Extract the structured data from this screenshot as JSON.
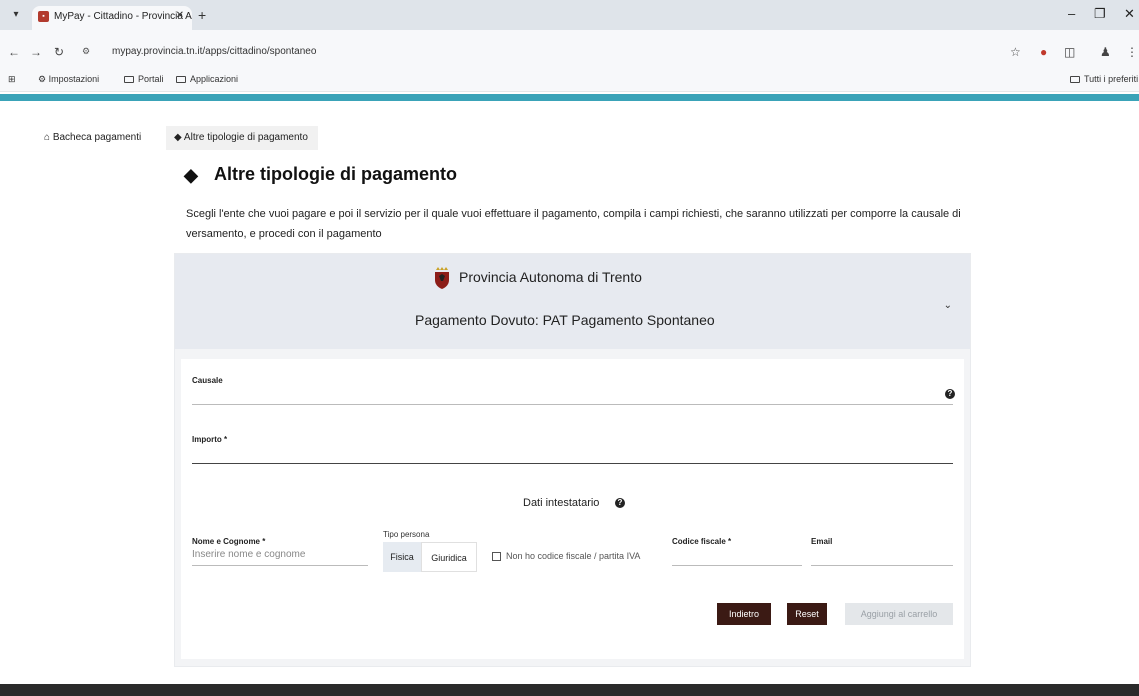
{
  "browser": {
    "tab_title": "MyPay - Cittadino - Provincia A",
    "url": "mypay.provincia.tn.it/apps/cittadino/spontaneo",
    "bookmarks": [
      "Impostazioni",
      "Portali",
      "Applicazioni"
    ],
    "bookmarks_right": "Tutti i preferiti"
  },
  "breadcrumb": {
    "home": "Bacheca pagamenti",
    "current": "Altre tipologie di pagamento"
  },
  "page": {
    "title": "Altre tipologie di pagamento",
    "intro": "Scegli l'ente che vuoi pagare e poi il servizio per il quale vuoi effettuare il pagamento, compila i campi richiesti, che saranno utilizzati per comporre la causale di versamento, e procedi con il pagamento"
  },
  "card": {
    "ente": "Provincia Autonoma di Trento",
    "servizio": "Pagamento Dovuto: PAT Pagamento Spontaneo"
  },
  "form": {
    "causale_label": "Causale",
    "importo_label": "Importo *",
    "intestatario_heading": "Dati intestatario",
    "nome_label": "Nome e Cognome *",
    "nome_placeholder": "Inserire nome e cognome",
    "tipo_persona_label": "Tipo persona",
    "tipo_persona_options": [
      "Fisica",
      "Giuridica"
    ],
    "no_cf_label": "Non ho codice fiscale / partita IVA",
    "cf_label": "Codice fiscale *",
    "email_label": "Email"
  },
  "buttons": {
    "indietro": "Indietro",
    "reset": "Reset",
    "aggiungi": "Aggiungi al carrello"
  },
  "colors": {
    "accent_band": "#3aa3b8",
    "button_dark": "#3b1a14"
  }
}
